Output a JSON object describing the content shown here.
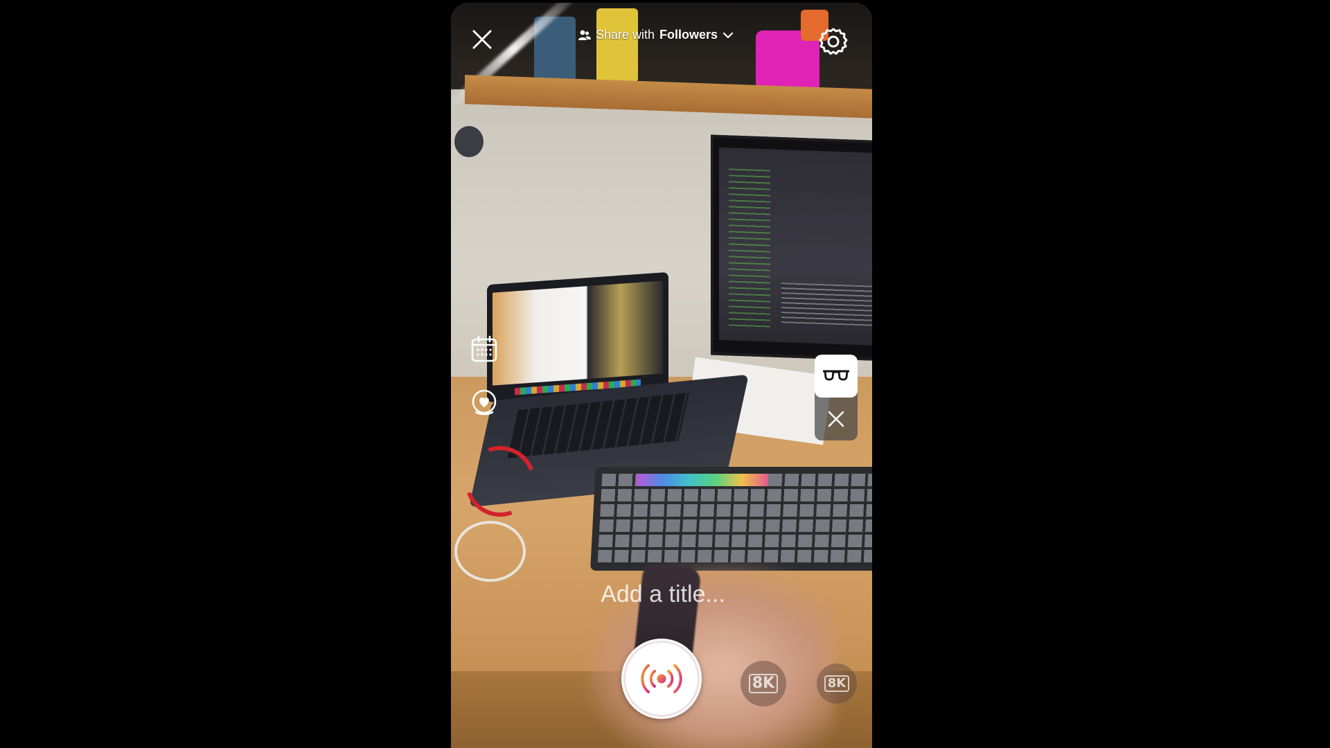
{
  "top_bar": {
    "close_icon": "close-icon",
    "share_prefix": "Share with",
    "share_audience": "Followers",
    "audience_icon": "people-icon",
    "dropdown_icon": "chevron-down-icon",
    "settings_icon": "gear-icon"
  },
  "side_tools": {
    "schedule_icon": "calendar-icon",
    "fundraiser_icon": "heart-badge-icon"
  },
  "filter_panel": {
    "active_icon": "glasses-icon",
    "dismiss_icon": "close-icon"
  },
  "title_input": {
    "placeholder": "Add a title..."
  },
  "bottom_bar": {
    "live_icon": "broadcast-icon",
    "effects": [
      {
        "label": "8K",
        "icon": "effect-8k-icon"
      },
      {
        "label": "8K",
        "icon": "effect-8k-icon"
      }
    ]
  },
  "colors": {
    "live_gradient_start": "#f6a02b",
    "live_gradient_end": "#d42a8f",
    "overlay_text": "#ffffff"
  }
}
